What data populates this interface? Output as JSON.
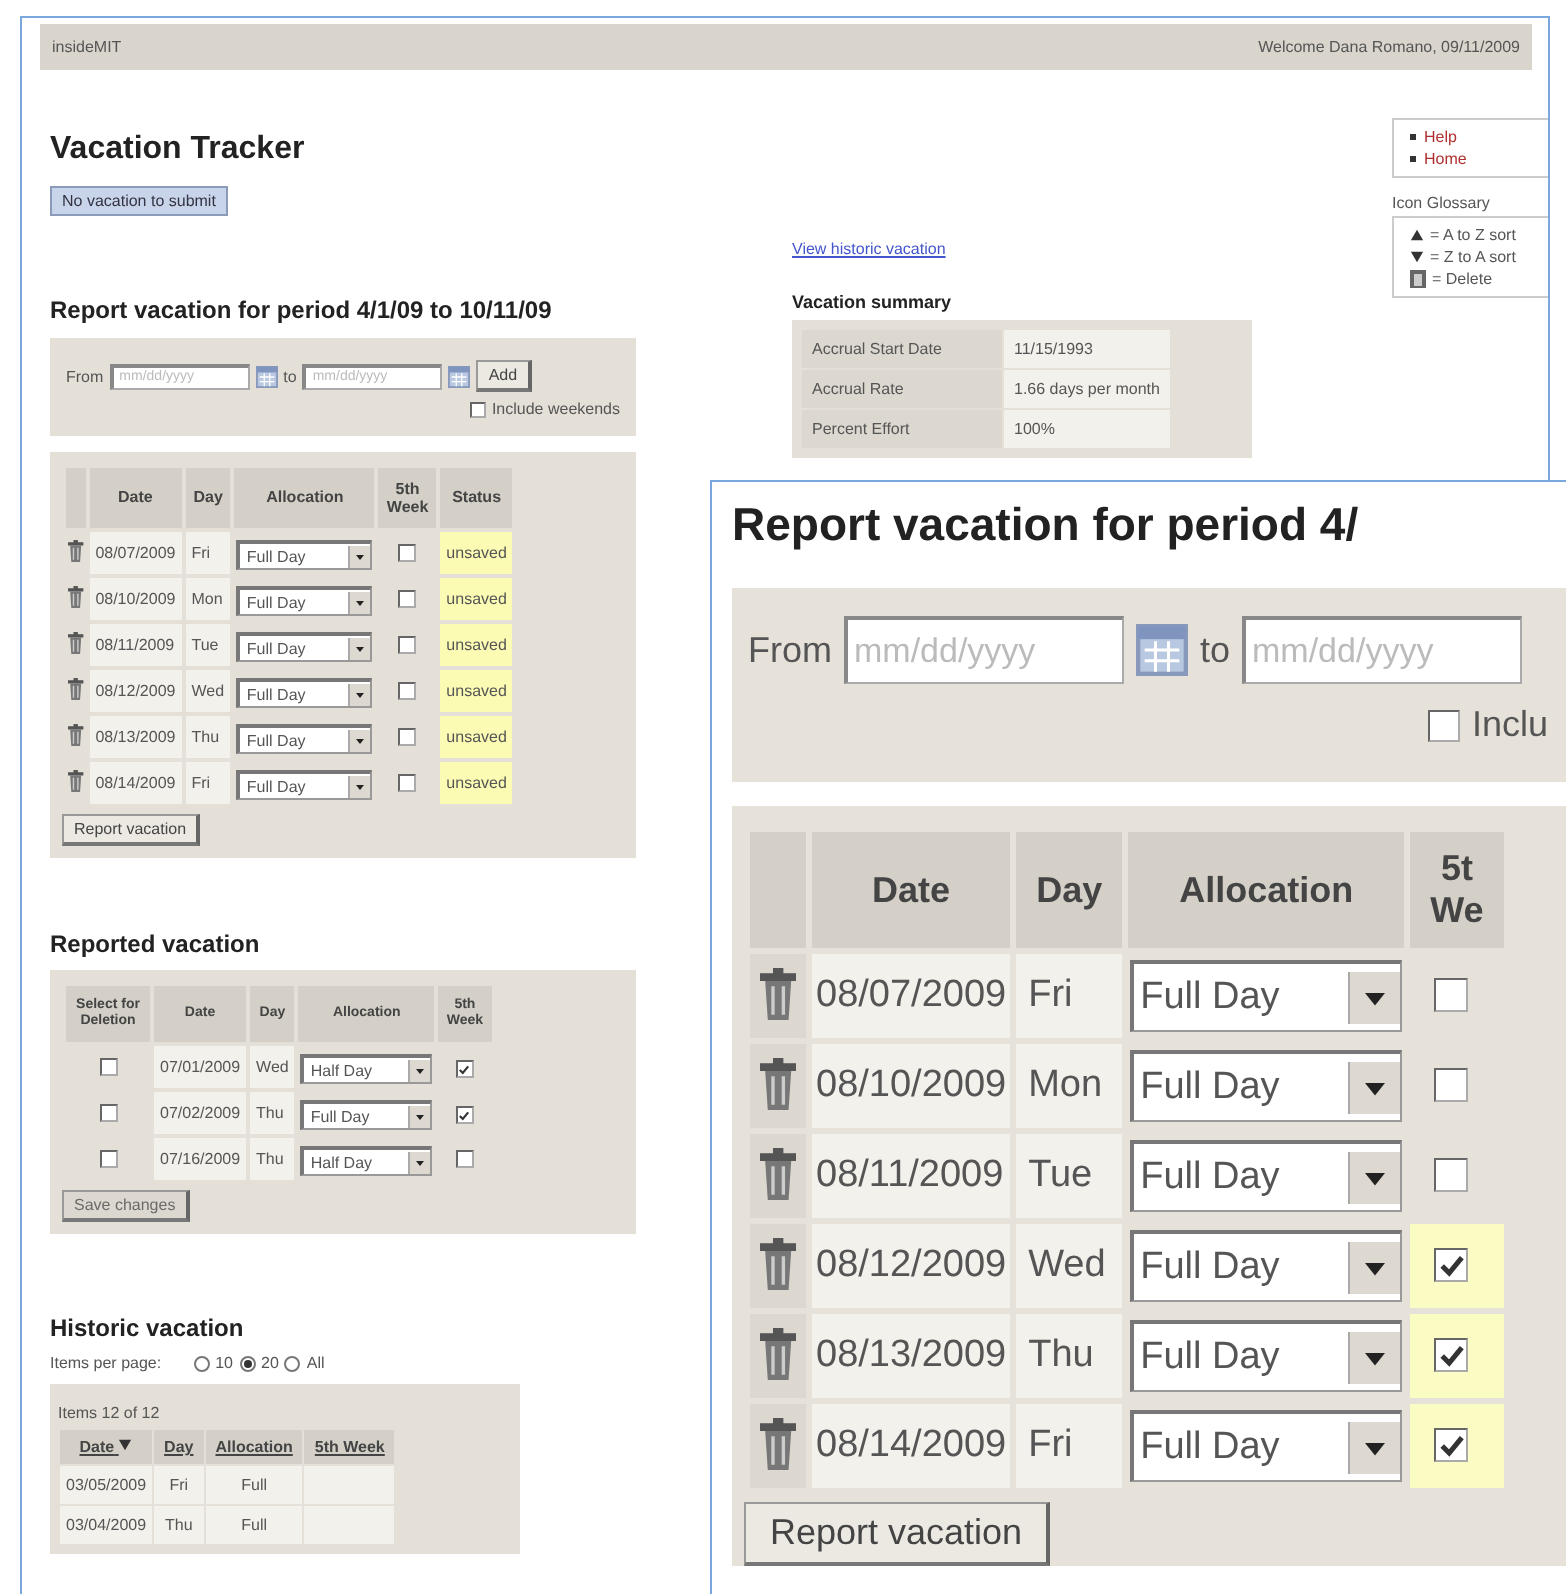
{
  "header": {
    "site": "insideMIT",
    "welcome": "Welcome Dana Romano, 09/11/2009"
  },
  "title": "Vacation Tracker",
  "submit_button": {
    "label": "No vacation to submit"
  },
  "report": {
    "heading": "Report vacation for period 4/1/09 to 10/11/09",
    "from_label": "From",
    "from_placeholder": "mm/dd/yyyy",
    "to_label": "to",
    "to_placeholder": "mm/dd/yyyy",
    "add_button": "Add",
    "include_weekends": {
      "label": "Include weekends",
      "checked": false
    },
    "columns": [
      "Date",
      "Day",
      "Allocation",
      "5th Week",
      "Status"
    ],
    "rows": [
      {
        "date": "08/07/2009",
        "day": "Fri",
        "allocation": "Full Day",
        "fifth_week": false,
        "status": "unsaved"
      },
      {
        "date": "08/10/2009",
        "day": "Mon",
        "allocation": "Full Day",
        "fifth_week": false,
        "status": "unsaved"
      },
      {
        "date": "08/11/2009",
        "day": "Tue",
        "allocation": "Full Day",
        "fifth_week": false,
        "status": "unsaved"
      },
      {
        "date": "08/12/2009",
        "day": "Wed",
        "allocation": "Full Day",
        "fifth_week": false,
        "status": "unsaved"
      },
      {
        "date": "08/13/2009",
        "day": "Thu",
        "allocation": "Full Day",
        "fifth_week": false,
        "status": "unsaved"
      },
      {
        "date": "08/14/2009",
        "day": "Fri",
        "allocation": "Full Day",
        "fifth_week": false,
        "status": "unsaved"
      }
    ],
    "button": "Report vacation"
  },
  "reported": {
    "heading": "Reported vacation",
    "columns": [
      "Select for Deletion",
      "Date",
      "Day",
      "Allocation",
      "5th Week"
    ],
    "rows": [
      {
        "selected": false,
        "date": "07/01/2009",
        "day": "Wed",
        "allocation": "Half Day",
        "fifth_week": true
      },
      {
        "selected": false,
        "date": "07/02/2009",
        "day": "Thu",
        "allocation": "Full Day",
        "fifth_week": true
      },
      {
        "selected": false,
        "date": "07/16/2009",
        "day": "Thu",
        "allocation": "Half Day",
        "fifth_week": false
      }
    ],
    "button": {
      "label": "Save changes",
      "disabled": true
    }
  },
  "historic": {
    "heading": "Historic vacation",
    "items_per_page_label": "Items per page:",
    "page_sizes": [
      {
        "label": "10",
        "selected": false
      },
      {
        "label": "20",
        "selected": true
      },
      {
        "label": "All",
        "selected": false
      }
    ],
    "count": "Items 12 of 12",
    "columns": [
      {
        "label": "Date",
        "sorted_descending": true
      },
      {
        "label": "Day",
        "sorted_descending": false
      },
      {
        "label": "Allocation",
        "sorted_descending": false
      },
      {
        "label": "5th Week",
        "sorted_descending": false
      }
    ],
    "rows": [
      {
        "date": "03/05/2009",
        "day": "Fri",
        "allocation": "Full",
        "fifth_week": ""
      },
      {
        "date": "03/04/2009",
        "day": "Thu",
        "allocation": "Full",
        "fifth_week": ""
      }
    ]
  },
  "view_historic_link": "View historic vacation",
  "summary": {
    "heading": "Vacation summary",
    "rows": [
      {
        "label": "Accrual Start Date",
        "value": "11/15/1993"
      },
      {
        "label": "Accrual Rate",
        "value": "1.66 days per month"
      },
      {
        "label": "Percent Effort",
        "value": "100%"
      }
    ]
  },
  "nav": [
    {
      "label": "Help"
    },
    {
      "label": "Home"
    }
  ],
  "glossary": {
    "heading": "Icon Glossary",
    "items": [
      {
        "kind": "sort-asc",
        "text": "= A to Z sort"
      },
      {
        "kind": "sort-desc",
        "text": "= Z to A sort"
      },
      {
        "kind": "delete",
        "text": "= Delete"
      }
    ]
  },
  "inset": {
    "heading": "Report vacation for period 4/",
    "from_label": "From",
    "from_placeholder": "mm/dd/yyyy",
    "to_label": "to",
    "to_placeholder": "mm/dd/yyyy",
    "include_weekends": {
      "label": "Inclu",
      "checked": false
    },
    "columns": [
      "Date",
      "Day",
      "Allocation",
      "5t\nWe"
    ],
    "rows": [
      {
        "date": "08/07/2009",
        "day": "Fri",
        "allocation": "Full Day",
        "fifth_week": false
      },
      {
        "date": "08/10/2009",
        "day": "Mon",
        "allocation": "Full Day",
        "fifth_week": false
      },
      {
        "date": "08/11/2009",
        "day": "Tue",
        "allocation": "Full Day",
        "fifth_week": false
      },
      {
        "date": "08/12/2009",
        "day": "Wed",
        "allocation": "Full Day",
        "fifth_week": true
      },
      {
        "date": "08/13/2009",
        "day": "Thu",
        "allocation": "Full Day",
        "fifth_week": true
      },
      {
        "date": "08/14/2009",
        "day": "Fri",
        "allocation": "Full Day",
        "fifth_week": true
      }
    ],
    "button": "Report vacation"
  }
}
